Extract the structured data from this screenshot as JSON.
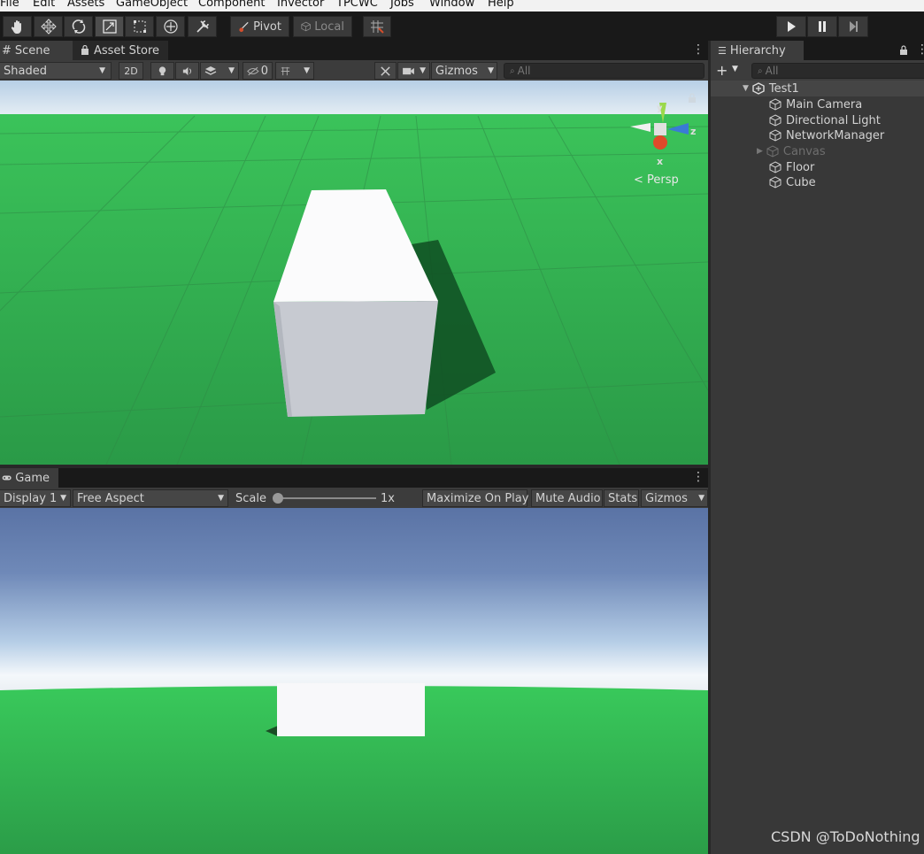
{
  "menu": [
    "File",
    "Edit",
    "Assets",
    "GameObject",
    "Component",
    "Invector",
    "TPCWC",
    "Jobs",
    "Window",
    "Help"
  ],
  "toolbar": {
    "tools": [
      "hand-tool-icon",
      "move-tool-icon",
      "rotate-tool-icon",
      "scale-tool-icon",
      "rect-tool-icon",
      "transform-tool-icon",
      "custom-tool-icon"
    ],
    "pivot_label": "Pivot",
    "local_label": "Local"
  },
  "scene_panel": {
    "tabs": [
      "Scene",
      "Asset Store"
    ],
    "draw_mode": "Shaded",
    "mode_2d": "2D",
    "hidden_count": "0",
    "gizmos_label": "Gizmos",
    "search_placeholder": "All",
    "gizmo_axes": {
      "y": "y",
      "z": "z",
      "x": "x"
    },
    "projection_label": "Persp"
  },
  "game_panel": {
    "tab": "Game",
    "display": "Display 1",
    "aspect": "Free Aspect",
    "scale_label": "Scale",
    "scale_value": "1x",
    "maximize_label": "Maximize On Play",
    "mute_label": "Mute Audio",
    "stats_label": "Stats",
    "gizmos_label": "Gizmos"
  },
  "hierarchy": {
    "tab": "Hierarchy",
    "search_placeholder": "All",
    "scene_name": "Test1",
    "items": [
      {
        "label": "Main Camera",
        "active": true
      },
      {
        "label": "Directional Light",
        "active": true
      },
      {
        "label": "NetworkManager",
        "active": true
      },
      {
        "label": "Canvas",
        "active": false
      },
      {
        "label": "Floor",
        "active": true
      },
      {
        "label": "Cube",
        "active": true
      }
    ]
  },
  "watermark": "CSDN @ToDoNothing",
  "colors": {
    "ground": "#2c9e4a",
    "cube": "#f4f4f6",
    "sky_top": "#5670a3",
    "editor_bg": "#383838"
  }
}
